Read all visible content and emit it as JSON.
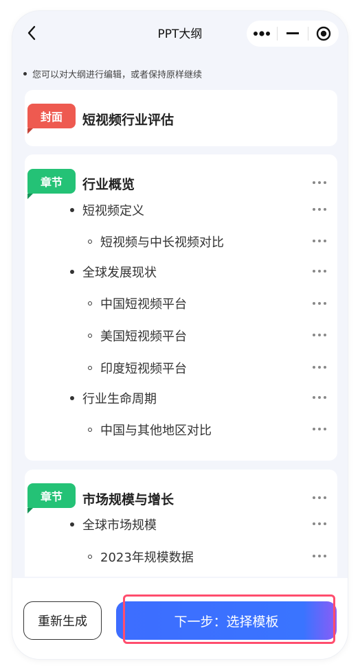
{
  "navbar": {
    "title": "PPT大纲"
  },
  "hint": "您可以对大纲进行编辑，或者保持原样继续",
  "cover": {
    "tag": "封面",
    "title": "短视频行业评估"
  },
  "sections": [
    {
      "tag": "章节",
      "title": "行业概览",
      "items": [
        {
          "level": 1,
          "text": "短视频定义"
        },
        {
          "level": 2,
          "text": "短视频与中长视频对比"
        },
        {
          "level": 1,
          "text": "全球发展现状"
        },
        {
          "level": 2,
          "text": "中国短视频平台"
        },
        {
          "level": 2,
          "text": "美国短视频平台"
        },
        {
          "level": 2,
          "text": "印度短视频平台"
        },
        {
          "level": 1,
          "text": "行业生命周期"
        },
        {
          "level": 2,
          "text": "中国与其他地区对比"
        }
      ]
    },
    {
      "tag": "章节",
      "title": "市场规模与增长",
      "items": [
        {
          "level": 1,
          "text": "全球市场规模"
        },
        {
          "level": 2,
          "text": "2023年规模数据"
        }
      ]
    }
  ],
  "bottom": {
    "regenerate": "重新生成",
    "next": "下一步：选择模板"
  },
  "icons": {
    "back": "back-chevron-icon",
    "more": "more-dots-icon",
    "minimize": "minimize-icon",
    "close": "target-close-icon",
    "item_more": "ellipsis-icon"
  },
  "colors": {
    "cover_tag": "#ee5a50",
    "chapter_tag": "#24c276",
    "primary": "#3a74ff",
    "highlight": "#ff4d6d"
  }
}
